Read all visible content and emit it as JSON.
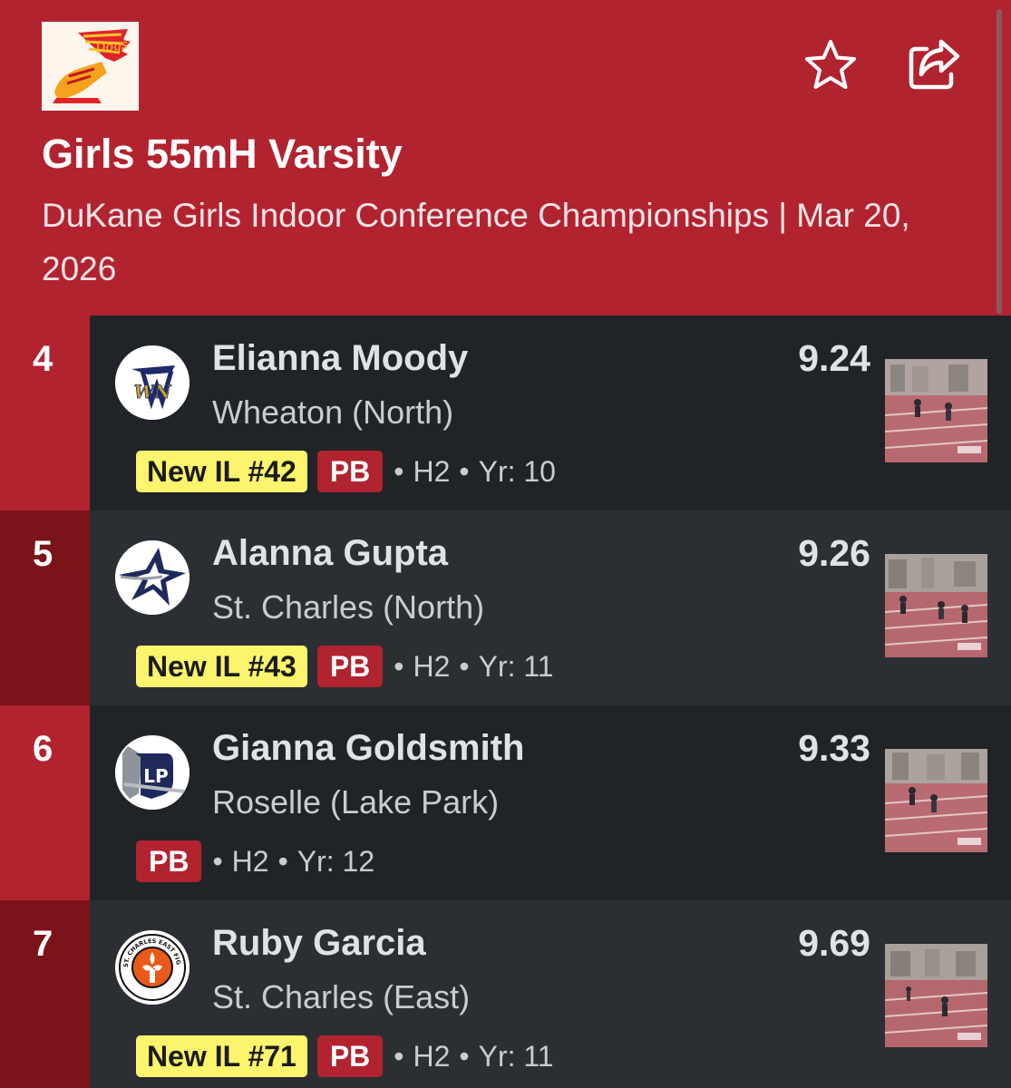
{
  "header": {
    "title": "Girls 55mH Varsity",
    "subtitle": "DuKane Girls Indoor Conference Championships | Mar 20, 2026",
    "logo_text": "Dogs",
    "favorite_icon": "star-outline-icon",
    "share_icon": "share-icon"
  },
  "colors": {
    "header_red": "#b22330",
    "place_dark": "#7a1419",
    "card_dark": "#202428",
    "card_mid": "#2b2f34",
    "badge_yellow": "#fbf46c"
  },
  "results": [
    {
      "place": "4",
      "name": "Elianna Moody",
      "school": "Wheaton (North)",
      "mark": "9.24",
      "ranking_badge": "New IL #42",
      "pb_badge": "PB",
      "heat": "H2",
      "year": "Yr: 10",
      "logo_text": "WN"
    },
    {
      "place": "5",
      "name": "Alanna Gupta",
      "school": "St. Charles (North)",
      "mark": "9.26",
      "ranking_badge": "New IL #43",
      "pb_badge": "PB",
      "heat": "H2",
      "year": "Yr: 11",
      "logo_text": ""
    },
    {
      "place": "6",
      "name": "Gianna Goldsmith",
      "school": "Roselle (Lake Park)",
      "mark": "9.33",
      "ranking_badge": "",
      "pb_badge": "PB",
      "heat": "H2",
      "year": "Yr: 12",
      "logo_text": "LP"
    },
    {
      "place": "7",
      "name": "Ruby Garcia",
      "school": "St. Charles (East)",
      "mark": "9.69",
      "ranking_badge": "New IL #71",
      "pb_badge": "PB",
      "heat": "H2",
      "year": "Yr: 11",
      "logo_text": "ST. CHARLES EAST FIGHTING SAINTS"
    }
  ]
}
